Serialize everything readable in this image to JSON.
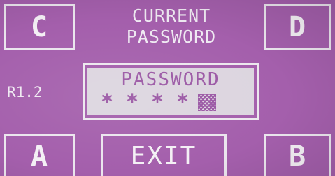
{
  "screen": {
    "title_line1": "CURRENT",
    "title_line2": "PASSWORD",
    "version": "R1.2"
  },
  "softkeys": {
    "top_left": "C",
    "top_right": "D",
    "bottom_left": "A",
    "bottom_center": "EXIT",
    "bottom_right": "B"
  },
  "password_field": {
    "label": "PASSWORD",
    "masked_chars": [
      "*",
      "*",
      "*",
      "*"
    ],
    "cursor_icon": "checkered-cursor-block"
  },
  "colors": {
    "background": "#a45fac",
    "foreground": "#f2eef2",
    "field_background": "#dcd5df",
    "field_text": "#9a57a4"
  }
}
